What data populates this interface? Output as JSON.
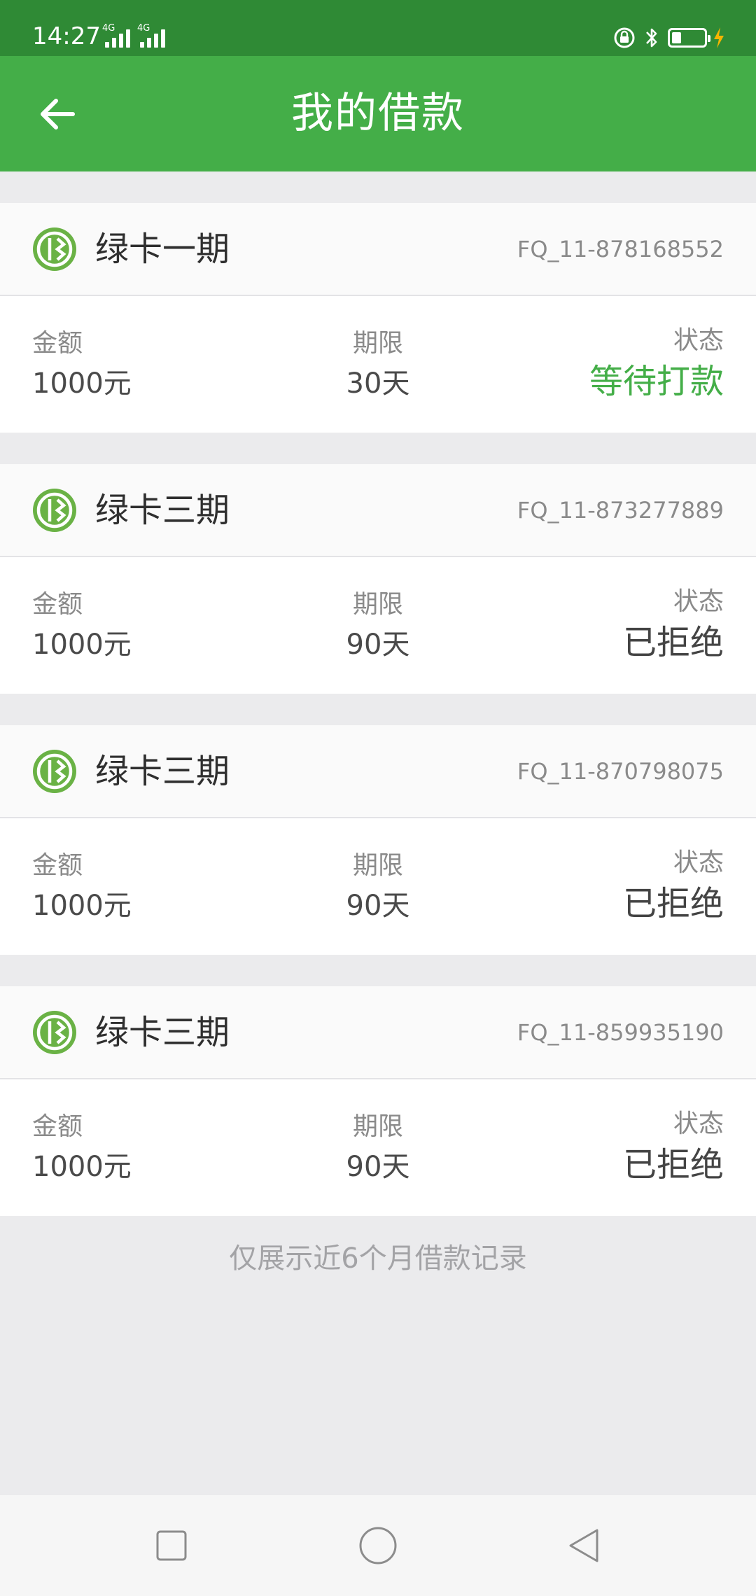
{
  "status_bar": {
    "time": "14:27",
    "signal_1": "4G",
    "signal_2": "4G",
    "battery_level": 0.25,
    "charging_color": "#f5b400"
  },
  "header": {
    "title": "我的借款",
    "back_icon": "arrow-left-icon"
  },
  "colors": {
    "primary": "#44ae48",
    "status_bar": "#2f8a35",
    "status_pending": "#44ae48"
  },
  "column_labels": {
    "amount": "金额",
    "term": "期限",
    "status": "状态"
  },
  "loans": [
    {
      "product": "绿卡一期",
      "order_no": "FQ_11-878168552",
      "amount": "1000元",
      "term": "30天",
      "status": "等待打款",
      "status_kind": "pending"
    },
    {
      "product": "绿卡三期",
      "order_no": "FQ_11-873277889",
      "amount": "1000元",
      "term": "90天",
      "status": "已拒绝",
      "status_kind": "rejected"
    },
    {
      "product": "绿卡三期",
      "order_no": "FQ_11-870798075",
      "amount": "1000元",
      "term": "90天",
      "status": "已拒绝",
      "status_kind": "rejected"
    },
    {
      "product": "绿卡三期",
      "order_no": "FQ_11-859935190",
      "amount": "1000元",
      "term": "90天",
      "status": "已拒绝",
      "status_kind": "rejected"
    }
  ],
  "footer_note": "仅展示近6个月借款记录",
  "nav": {
    "recent_icon": "square-icon",
    "home_icon": "circle-icon",
    "back_icon": "triangle-back-icon"
  }
}
